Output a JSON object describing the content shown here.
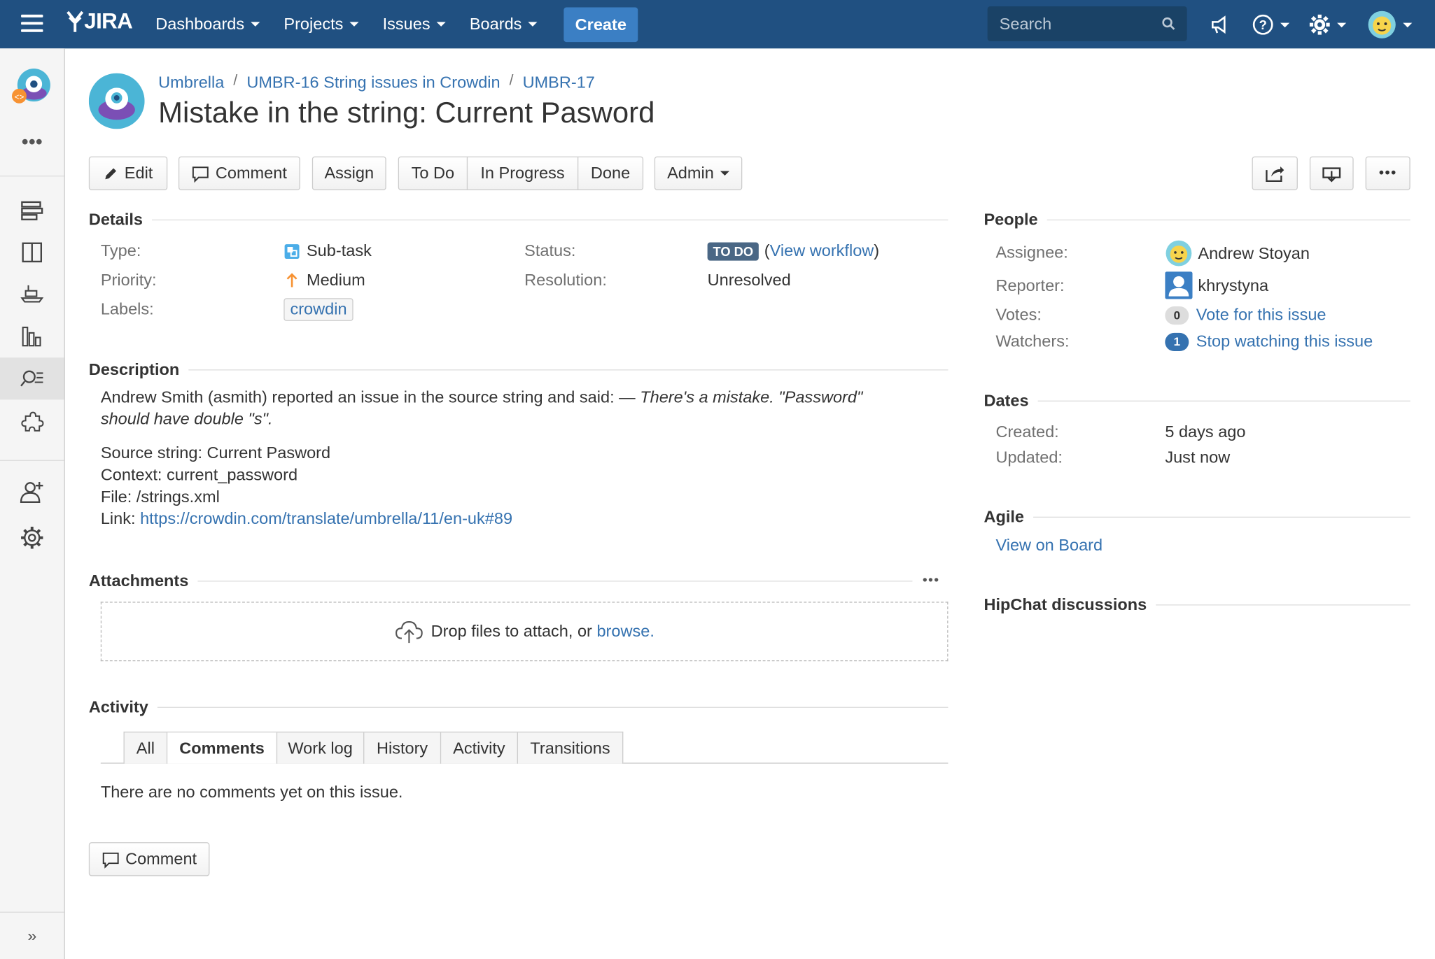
{
  "topbar": {
    "logo_text": "JIRA",
    "nav": [
      "Dashboards",
      "Projects",
      "Issues",
      "Boards"
    ],
    "create_label": "Create",
    "search_placeholder": "Search",
    "bg_color": "#205081"
  },
  "breadcrumbs": {
    "project": "Umbrella",
    "parent": "UMBR-16 String issues in Crowdin",
    "issue_key": "UMBR-17"
  },
  "issue_title": "Mistake in the string: Current Pasword",
  "toolbar": {
    "edit": "Edit",
    "comment": "Comment",
    "assign": "Assign",
    "workflow": [
      "To Do",
      "In Progress",
      "Done"
    ],
    "admin": "Admin"
  },
  "details": {
    "heading": "Details",
    "type_label": "Type:",
    "type_value": "Sub-task",
    "priority_label": "Priority:",
    "priority_value": "Medium",
    "labels_label": "Labels:",
    "labels_value": "crowdin",
    "status_label": "Status:",
    "status_value": "TO DO",
    "view_workflow": "View workflow",
    "resolution_label": "Resolution:",
    "resolution_value": "Unresolved"
  },
  "description": {
    "heading": "Description",
    "line1_plain": "Andrew Smith (asmith) reported an issue in the source string and said: — ",
    "line1_italic": "There's a mistake. \"Password\"",
    "line2_italic": "should have double \"s\".",
    "source_string": "Source string: Current Pasword",
    "context": "Context: current_password",
    "file": "File: /strings.xml",
    "link_label": "Link:",
    "link_url": "https://crowdin.com/translate/umbrella/11/en-uk#89"
  },
  "attachments": {
    "heading": "Attachments",
    "drop_text": "Drop files to attach, or",
    "browse": "browse."
  },
  "activity": {
    "heading": "Activity",
    "tabs": [
      "All",
      "Comments",
      "Work log",
      "History",
      "Activity",
      "Transitions"
    ],
    "active_tab": "Comments",
    "empty_text": "There are no comments yet on this issue.",
    "comment_button": "Comment"
  },
  "people": {
    "heading": "People",
    "assignee_label": "Assignee:",
    "assignee_value": "Andrew Stoyan",
    "reporter_label": "Reporter:",
    "reporter_value": "khrystyna",
    "votes_label": "Votes:",
    "votes_count": "0",
    "votes_link": "Vote for this issue",
    "watchers_label": "Watchers:",
    "watchers_count": "1",
    "watchers_link": "Stop watching this issue"
  },
  "dates": {
    "heading": "Dates",
    "created_label": "Created:",
    "created_value": "5 days ago",
    "updated_label": "Updated:",
    "updated_value": "Just now"
  },
  "agile": {
    "heading": "Agile",
    "link": "View on Board"
  },
  "hipchat": {
    "heading": "HipChat discussions"
  },
  "icons": [
    "menu-icon",
    "jira-logo-icon",
    "search-icon",
    "megaphone-icon",
    "help-icon",
    "settings-icon",
    "user-avatar-icon",
    "project-avatar-icon",
    "more-icon",
    "backlog-icon",
    "board-icon",
    "releases-icon",
    "reports-icon",
    "issues-icon",
    "add-ons-icon",
    "add-people-icon",
    "project-settings-icon",
    "expand-sidebar-icon",
    "pencil-icon",
    "comment-icon",
    "share-icon",
    "export-icon",
    "subtask-icon",
    "priority-medium-icon",
    "upload-cloud-icon"
  ],
  "colors": {
    "link": "#3572b0",
    "status_lozenge": "#4a6785",
    "priority": "#f79232",
    "create_button": "#3b7fc4"
  }
}
